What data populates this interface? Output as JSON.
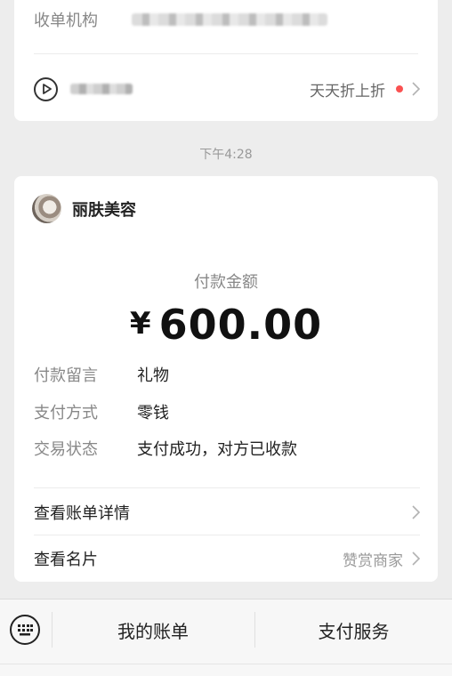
{
  "top_card": {
    "merchant_label": "收单机构",
    "promo_text": "天天折上折"
  },
  "time": "下午4:28",
  "payment": {
    "sender_name": "丽肤美容",
    "amount_label": "付款金额",
    "currency_symbol": "¥",
    "amount": "600.00",
    "details": [
      {
        "key": "付款留言",
        "value": "礼物"
      },
      {
        "key": "支付方式",
        "value": "零钱"
      },
      {
        "key": "交易状态",
        "value": "支付成功，对方已收款"
      }
    ],
    "links": [
      {
        "label": "查看账单详情",
        "sub": ""
      },
      {
        "label": "查看名片",
        "sub": "赞赏商家"
      }
    ]
  },
  "bottom_bar": {
    "my_bills": "我的账单",
    "pay_service": "支付服务"
  },
  "colors": {
    "background": "#ededed",
    "card": "#ffffff",
    "notice_dot": "#fa5151"
  },
  "icons": [
    "play-circle-icon",
    "chevron-right-icon",
    "keyboard-icon",
    "avatar"
  ]
}
